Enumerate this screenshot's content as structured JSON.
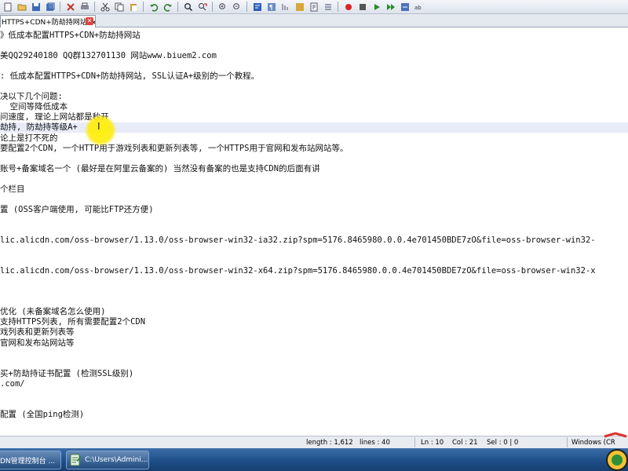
{
  "tab": {
    "title": "HTTPS+CDN+防劫持网站.txt",
    "close_glyph": "✕"
  },
  "editor": {
    "lines": [
      "》低成本配置HTTPS+CDN+防劫持网站",
      "",
      "美QQ29240180 QQ群132701130 网站www.biuem2.com",
      "",
      ": 低成本配置HTTPS+CDN+防劫持网站, SSL认证A+级别的一个教程。",
      "",
      "决以下几个问题:",
      "  空间等降低成本",
      "问速度, 理论上网站都是秒开",
      "劫持, 防劫持等级A+",
      "论上是打不死的",
      "要配置2个CDN, 一个HTTP用于游戏列表和更新列表等, 一个HTTPS用于官网和发布站网站等。",
      "",
      "账号+备案域名一个 (最好是在阿里云备案的) 当然没有备案的也是支持CDN的后面有讲",
      "",
      "个栏目",
      "",
      "置 (OSS客户端使用, 可能比FTP还方便)",
      "",
      "",
      "lic.alicdn.com/oss-browser/1.13.0/oss-browser-win32-ia32.zip?spm=5176.8465980.0.0.4e701450BDE7zO&file=oss-browser-win32-",
      "",
      "",
      "lic.alicdn.com/oss-browser/1.13.0/oss-browser-win32-x64.zip?spm=5176.8465980.0.0.4e701450BDE7zO&file=oss-browser-win32-x",
      "",
      "",
      "",
      "优化 (未备案域名怎么使用)",
      "支持HTTPS列表, 所有需要配置2个CDN",
      "戏列表和更新列表等",
      "官网和发布站网站等",
      "",
      "",
      "买+防劫持证书配置 (检测SSL级别)",
      ".com/",
      "",
      "",
      "配置 (全国ping检测)"
    ],
    "current_line_index": 9,
    "cursor_glyph": "I"
  },
  "statusbar": {
    "length": "length : 1,612",
    "lines": "lines : 40",
    "ln": "Ln : 10",
    "col": "Col : 21",
    "sel": "Sel : 0 | 0",
    "encoding": "Windows (CR"
  },
  "taskbar": {
    "items": [
      {
        "label": "DN管理控制台 ...",
        "icon": "browser-icon"
      },
      {
        "label": "C:\\Users\\Admini...",
        "icon": "notepad-icon"
      }
    ]
  }
}
